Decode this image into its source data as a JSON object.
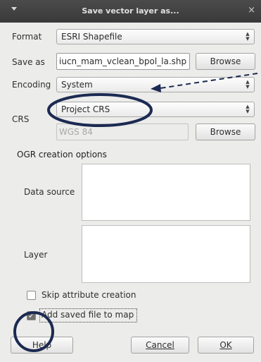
{
  "window": {
    "title": "Save vector layer as...",
    "menu_icon": "chevron-down-icon",
    "close_icon": "close-icon",
    "close_glyph": "×"
  },
  "form": {
    "format_label": "Format",
    "format_value": "ESRI Shapefile",
    "save_as_label": "Save as",
    "save_as_value": "iucn_mam_vclean_bpol_la.shp",
    "browse_label": "Browse",
    "encoding_label": "Encoding",
    "encoding_value": "System",
    "crs_label": "CRS",
    "crs_value": "Project CRS",
    "crs_name_value": "WGS 84",
    "crs_browse_label": "Browse"
  },
  "ogr": {
    "group_title": "OGR creation options",
    "data_source_label": "Data source",
    "layer_label": "Layer"
  },
  "options": {
    "skip_attribute_label": "Skip attribute creation",
    "skip_attribute_checked": false,
    "add_to_map_label": "Add saved file to map",
    "add_to_map_checked": true
  },
  "buttons": {
    "help_label": "Help",
    "cancel_label": "Cancel",
    "ok_label": "OK"
  },
  "annotation": {
    "color": "#1c2a52"
  }
}
